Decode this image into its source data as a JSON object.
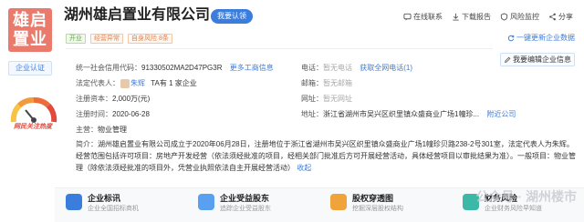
{
  "company": {
    "logo_text_line1": "雄启",
    "logo_text_line2": "置业",
    "name": "湖州雄启置业有限公司",
    "claim_label": "我要认领",
    "tags": [
      "开业",
      "经营异常",
      "自身风险 8条"
    ],
    "cert_label": "企业认证",
    "focus_label": "网民关注热度"
  },
  "actions": {
    "online": "在线联系",
    "report": "下载报告",
    "risk": "风险监控",
    "share": "分享",
    "new_biz": "一键更新企业数据",
    "edit": "我要编辑企业信息"
  },
  "info": {
    "credit_code_label": "统一社会信用代码：",
    "credit_code": "91330502MA2D47PG3R",
    "more_biz": "更多工商信息",
    "legal_label": "法定代表人：",
    "legal_name": "朱辉",
    "legal_extra": "TA有 1 家企业",
    "capital_label": "注册资本：",
    "capital": "2,000万(元)",
    "date_label": "注册时间：",
    "date": "2020-06-28",
    "host_label": "主营：",
    "host": "物业管理",
    "phone_label": "电话：",
    "phone": "暂无电话",
    "get_phone": "获取全网电话(1)",
    "email_label": "邮箱：",
    "email": "暂无邮箱",
    "web_label": "网址：",
    "web": "暂无网址",
    "addr_label": "地址：",
    "addr": "浙江省湖州市吴兴区织里镇众盛商业广场1幢珍...",
    "nearby": "附近公司"
  },
  "intro": {
    "label": "简介：",
    "text": "湖州雄启置业有限公司成立于2020年06月28日，注册地位于浙江省湖州市吴兴区织里镇众盛商业广场1幢珍贝路238-2号301室，法定代表人为朱辉。经营范围包括许可项目：房地产开发经营（依法须经批准的项目，经相关部门批准后方可开展经营活动，具体经营项目以审批结果为准）。一般项目：物业管理（除依法须经批准的项目外，凭营业执照依法自主开展经营活动）",
    "collapse": "收起"
  },
  "bottom_cards": [
    {
      "title": "企业标讯",
      "sub": "企业全国招标商机",
      "color": "#3b7ddd"
    },
    {
      "title": "企业受益股东",
      "sub": "追踪企业受益股东",
      "color": "#5aa0f0"
    },
    {
      "title": "股权穿透图",
      "sub": "挖掘深层股权结构",
      "color": "#f0a23b"
    },
    {
      "title": "财务风险",
      "sub": "企业财务风险早知道",
      "color": "#3bb8a6"
    }
  ],
  "watermark": "公众号 · 湖州楼市",
  "colors": {
    "accent": "#3b7ddd",
    "logo": "#ea7a6b",
    "danger": "#e14a3d"
  }
}
